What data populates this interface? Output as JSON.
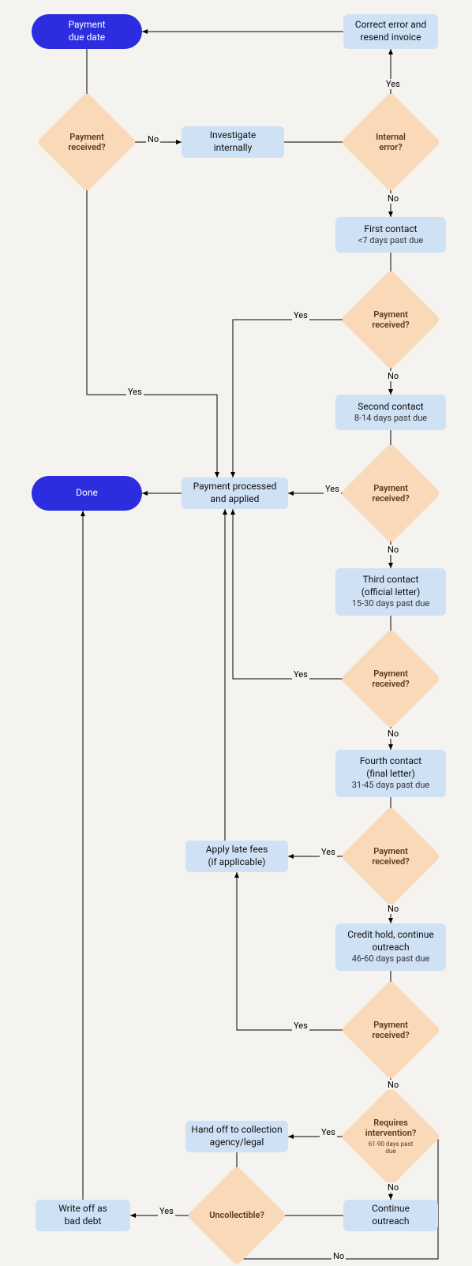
{
  "nodes": {
    "start": "Payment\ndue date",
    "done": "Done",
    "correct_error": "Correct error and\nresend invoice",
    "investigate": "Investigate\ninternally",
    "first_contact": "First contact",
    "first_contact_sub": "<7 days past due",
    "second_contact": "Second contact",
    "second_contact_sub": "8-14 days past due",
    "third_contact": "Third contact\n(official letter)",
    "third_contact_sub": "15-30 days past due",
    "fourth_contact": "Fourth contact\n(final letter)",
    "fourth_contact_sub": "31-45 days past due",
    "credit_hold": "Credit hold, continue\noutreach",
    "credit_hold_sub": "46-60 days past due",
    "payment_processed": "Payment processed\nand applied",
    "apply_late_fees": "Apply late fees\n(if applicable)",
    "hand_off": "Hand off to collection\nagency/legal",
    "continue_outreach": "Continue\noutreach",
    "write_off": "Write off as\nbad debt"
  },
  "decisions": {
    "payment_received": "Payment\nreceived?",
    "internal_error": "Internal\nerror?",
    "requires_intervention": "Requires\nintervention?",
    "requires_intervention_sub": "61-90 days past\ndue",
    "uncollectible": "Uncollectible?"
  },
  "labels": {
    "yes": "Yes",
    "no": "No"
  }
}
